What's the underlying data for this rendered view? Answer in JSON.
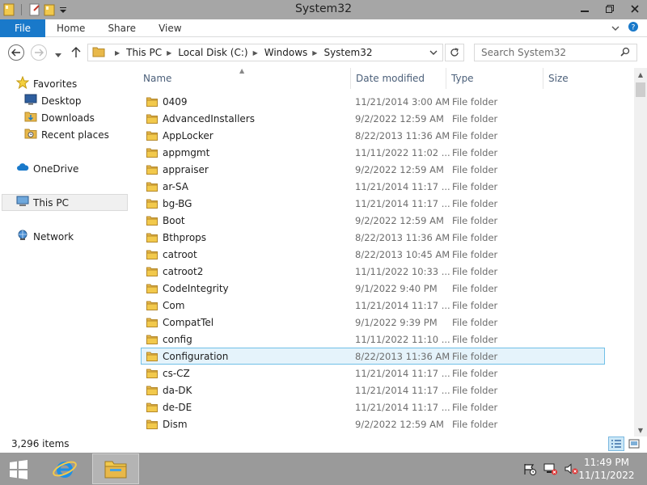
{
  "window": {
    "title": "System32"
  },
  "ribbon": {
    "tabs": {
      "file": "File",
      "home": "Home",
      "share": "Share",
      "view": "View"
    }
  },
  "address": {
    "crumbs": [
      "This PC",
      "Local Disk (C:)",
      "Windows",
      "System32"
    ],
    "search_placeholder": "Search System32"
  },
  "nav": {
    "favorites": "Favorites",
    "desktop": "Desktop",
    "downloads": "Downloads",
    "recent": "Recent places",
    "onedrive": "OneDrive",
    "thispc": "This PC",
    "network": "Network"
  },
  "columns": {
    "name": "Name",
    "date": "Date modified",
    "type": "Type",
    "size": "Size"
  },
  "files": [
    {
      "name": "0409",
      "date": "11/21/2014 3:00 AM",
      "type": "File folder"
    },
    {
      "name": "AdvancedInstallers",
      "date": "9/2/2022 12:59 AM",
      "type": "File folder"
    },
    {
      "name": "AppLocker",
      "date": "8/22/2013 11:36 AM",
      "type": "File folder"
    },
    {
      "name": "appmgmt",
      "date": "11/11/2022 11:02 ...",
      "type": "File folder"
    },
    {
      "name": "appraiser",
      "date": "9/2/2022 12:59 AM",
      "type": "File folder"
    },
    {
      "name": "ar-SA",
      "date": "11/21/2014 11:17 ...",
      "type": "File folder"
    },
    {
      "name": "bg-BG",
      "date": "11/21/2014 11:17 ...",
      "type": "File folder"
    },
    {
      "name": "Boot",
      "date": "9/2/2022 12:59 AM",
      "type": "File folder"
    },
    {
      "name": "Bthprops",
      "date": "8/22/2013 11:36 AM",
      "type": "File folder"
    },
    {
      "name": "catroot",
      "date": "8/22/2013 10:45 AM",
      "type": "File folder"
    },
    {
      "name": "catroot2",
      "date": "11/11/2022 10:33 ...",
      "type": "File folder"
    },
    {
      "name": "CodeIntegrity",
      "date": "9/1/2022 9:40 PM",
      "type": "File folder"
    },
    {
      "name": "Com",
      "date": "11/21/2014 11:17 ...",
      "type": "File folder"
    },
    {
      "name": "CompatTel",
      "date": "9/1/2022 9:39 PM",
      "type": "File folder"
    },
    {
      "name": "config",
      "date": "11/11/2022 11:10 ...",
      "type": "File folder"
    },
    {
      "name": "Configuration",
      "date": "8/22/2013 11:36 AM",
      "type": "File folder",
      "selected": true
    },
    {
      "name": "cs-CZ",
      "date": "11/21/2014 11:17 ...",
      "type": "File folder"
    },
    {
      "name": "da-DK",
      "date": "11/21/2014 11:17 ...",
      "type": "File folder"
    },
    {
      "name": "de-DE",
      "date": "11/21/2014 11:17 ...",
      "type": "File folder"
    },
    {
      "name": "Dism",
      "date": "9/2/2022 12:59 AM",
      "type": "File folder"
    }
  ],
  "status": {
    "items": "3,296 items"
  },
  "taskbar": {
    "time": "11:49 PM",
    "date": "11/11/2022"
  },
  "colors": {
    "accent": "#1979ca",
    "selection": "#e5f3fb",
    "selection_border": "#70c0e7",
    "folder": "#e8b84a",
    "taskbar": "#9a9a9a"
  }
}
